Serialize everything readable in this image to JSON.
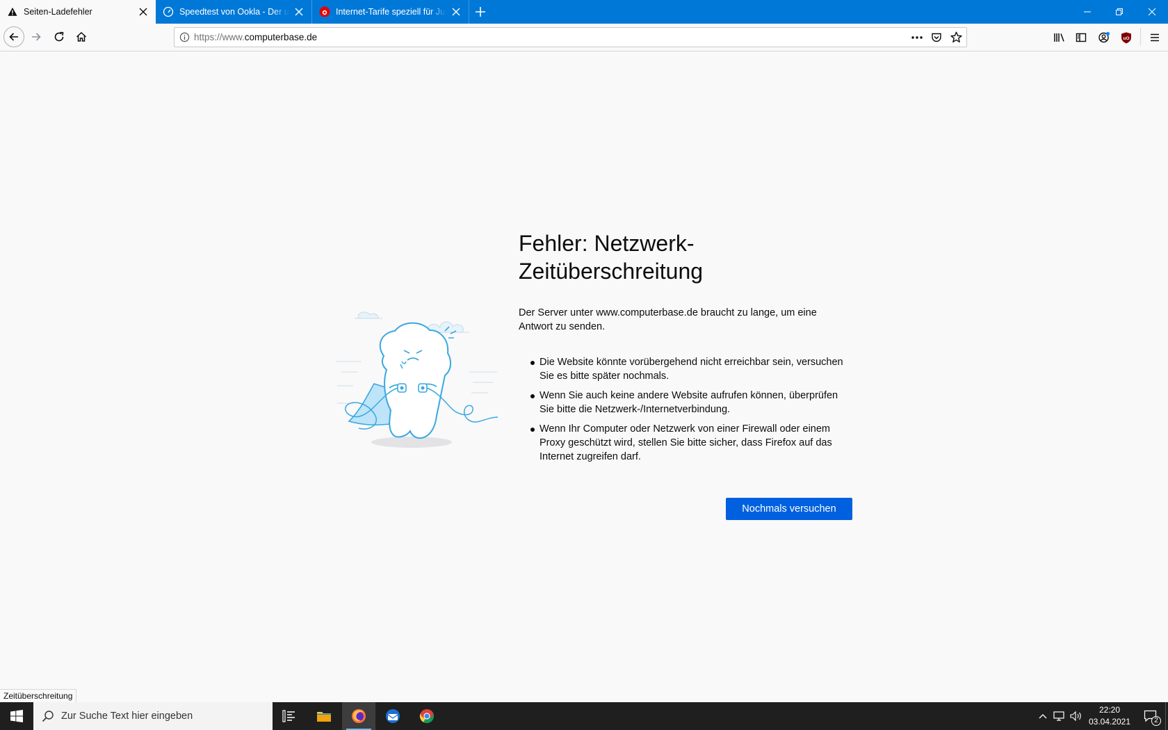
{
  "tabs": [
    {
      "title": "Seiten-Ladefehler",
      "icon": "warning-icon",
      "active": true
    },
    {
      "title": "Speedtest von Ookla - Der umfassende",
      "icon": "speedometer-icon",
      "active": false
    },
    {
      "title": "Internet-Tarife speziell für Junge Leute",
      "icon": "vodafone-icon",
      "active": false
    }
  ],
  "window_controls": {
    "minimize": "minimize-icon",
    "restore": "restore-icon",
    "close": "close-icon"
  },
  "url": {
    "prefix": "https://www.",
    "host": "computerbase.de"
  },
  "error": {
    "title": "Fehler: Netzwerk-Zeitüberschreitung",
    "description": "Der Server unter www.computerbase.de braucht zu lange, um eine Antwort zu senden.",
    "items": [
      "Die Website könnte vorübergehend nicht erreichbar sein, versuchen Sie es bitte später nochmals.",
      "Wenn Sie auch keine andere Website aufrufen können, überprüfen Sie bitte die Netzwerk-/Internetverbindung.",
      "Wenn Ihr Computer oder Netzwerk von einer Firewall oder einem Proxy geschützt wird, stellen Sie bitte sicher, dass Firefox auf das Internet zugreifen darf."
    ],
    "retry_label": "Nochmals versuchen"
  },
  "status_text": "Zeitüberschreitung",
  "taskbar": {
    "search_placeholder": "Zur Suche Text hier eingeben",
    "clock_time": "22:20",
    "clock_date": "03.04.2021",
    "notification_count": "2"
  },
  "colors": {
    "titlebar": "#0078d7",
    "button": "#0060df",
    "taskbar": "#1f1f1f"
  }
}
